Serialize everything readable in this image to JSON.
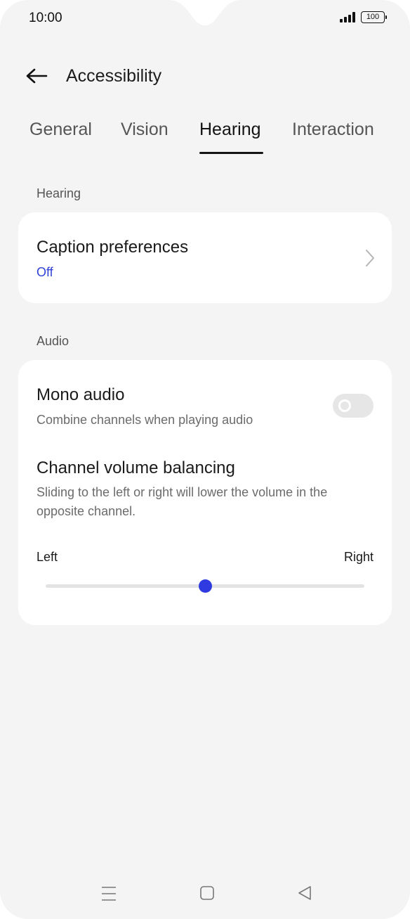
{
  "status_bar": {
    "time": "10:00",
    "battery": "100"
  },
  "header": {
    "back_icon": "arrow-left-icon",
    "title": "Accessibility"
  },
  "tabs": [
    {
      "label": "General",
      "active": false
    },
    {
      "label": "Vision",
      "active": false
    },
    {
      "label": "Hearing",
      "active": true
    },
    {
      "label": "Interaction",
      "active": false
    }
  ],
  "hearing_section": {
    "label": "Hearing",
    "caption_preferences": {
      "title": "Caption preferences",
      "value": "Off"
    }
  },
  "audio_section": {
    "label": "Audio",
    "mono_audio": {
      "title": "Mono audio",
      "subtitle": "Combine channels when playing audio",
      "enabled": false
    },
    "channel_balance": {
      "title": "Channel volume balancing",
      "description": "Sliding to the left or right will lower the volume in the opposite channel.",
      "left_label": "Left",
      "right_label": "Right",
      "value": 0.5
    }
  },
  "nav_bar": {
    "icons": [
      "menu-icon",
      "home-icon",
      "back-icon"
    ]
  },
  "colors": {
    "accent": "#2f3be0",
    "value_text": "#2f41d6",
    "background": "#f4f4f4",
    "card": "#ffffff"
  }
}
